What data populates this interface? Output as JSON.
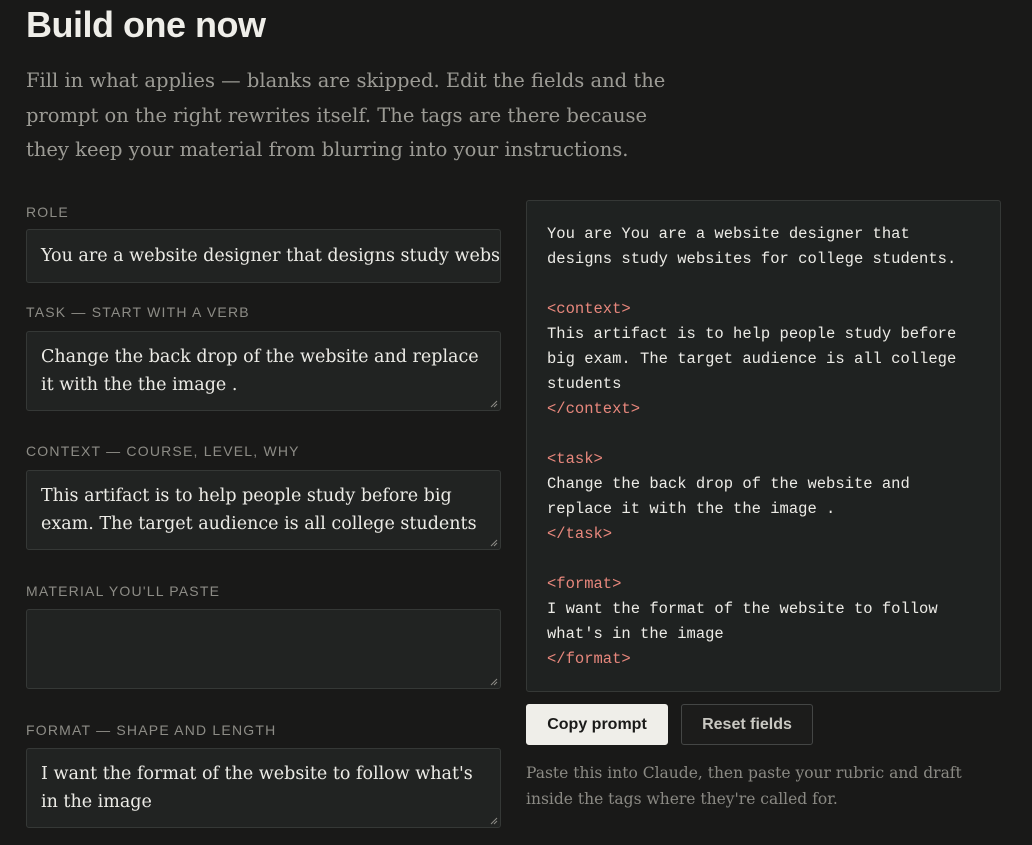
{
  "section": {
    "heading": "Build one now",
    "intro": "Fill in what applies — blanks are skipped. Edit the fields and the prompt on the right rewrites itself. The tags are there because they keep your material from blurring into your instructions."
  },
  "fields": {
    "role": {
      "label": "ROLE",
      "value": "You are a website designer that designs study webs"
    },
    "task": {
      "label": "TASK — START WITH A VERB",
      "value": "Change the back drop of the website and replace it with the the image ."
    },
    "context": {
      "label": "CONTEXT — COURSE, LEVEL, WHY",
      "value": "This artifact is to help people study before big exam. The target audience is all college students"
    },
    "material": {
      "label": "MATERIAL YOU'LL PASTE",
      "value": ""
    },
    "format": {
      "label": "FORMAT — SHAPE AND LENGTH",
      "value": "I want the format of the website to follow what's in the image"
    }
  },
  "preview": {
    "role_line": "You are You are a website designer that designs study websites for college students.",
    "context_open": "<context>",
    "context_body": "This artifact is to help people study before big exam. The target audience is all college students",
    "context_close": "</context>",
    "task_open": "<task>",
    "task_body": "Change the back drop of the website and replace it with the the image .",
    "task_close": "</task>",
    "format_open": "<format>",
    "format_body": "I want the format of the website to follow what's in the image",
    "format_close": "</format>"
  },
  "actions": {
    "copy_label": "Copy prompt",
    "reset_label": "Reset fields"
  },
  "note": "Paste this into Claude, then paste your rubric and draft inside the tags where they're called for.",
  "colors": {
    "background": "#191918",
    "panel": "#212322",
    "tag_accent": "#e7877c",
    "primary_button": "#efeee9"
  }
}
